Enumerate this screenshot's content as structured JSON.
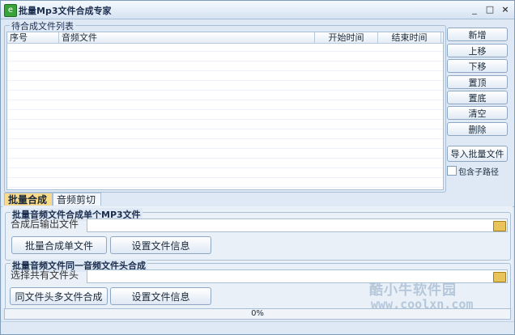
{
  "window": {
    "title": "批量Mp3文件合成专家",
    "minimize": "_",
    "maximize": "□",
    "close": "×",
    "app_icon": "e"
  },
  "file_list": {
    "group_title": "待合成文件列表",
    "columns": [
      "序号",
      "音频文件",
      "开始时间",
      "结束时间"
    ]
  },
  "side_buttons": {
    "add": "新增",
    "move_up": "上移",
    "move_down": "下移",
    "to_top": "置顶",
    "to_bottom": "置底",
    "clear": "清空",
    "delete": "删除",
    "import_batch": "导入批量文件",
    "include_subpath": "包含子路径",
    "include_subpath_checked": false
  },
  "tabs": [
    {
      "label": "批量合成",
      "active": true
    },
    {
      "label": "音频剪切",
      "active": false
    }
  ],
  "section1": {
    "title": "批量音频文件合成单个MP3文件",
    "output_label": "合成后输出文件",
    "output_value": "",
    "btn_merge": "批量合成单文件",
    "btn_info": "设置文件信息"
  },
  "section2": {
    "title": "批量音频文件同一音频文件头合成",
    "header_label": "选择共有文件头",
    "header_value": "",
    "btn_merge": "同文件头多文件合成",
    "btn_info": "设置文件信息"
  },
  "progress": {
    "value": 0,
    "label": "0%"
  },
  "watermark": {
    "cn": "酷小牛软件园",
    "url": "www.coolxn.com"
  },
  "colors": {
    "accent_tab": "#f9d98a",
    "window_bg": "#dfe9f5",
    "border": "#a9bfd6"
  }
}
